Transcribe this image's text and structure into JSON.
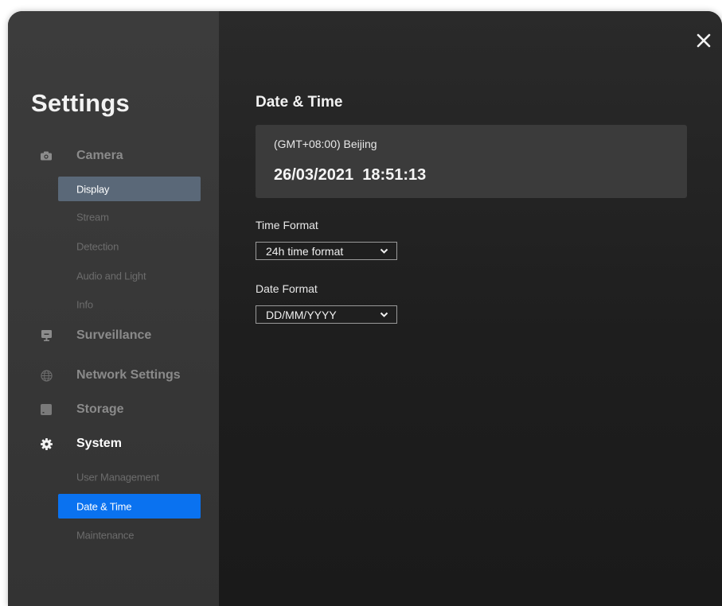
{
  "sidebar": {
    "title": "Settings",
    "groups": [
      {
        "label": "Camera",
        "icon": "camera-icon"
      },
      {
        "label": "Surveillance",
        "icon": "monitor-icon"
      },
      {
        "label": "Network Settings",
        "icon": "globe-icon"
      },
      {
        "label": "Storage",
        "icon": "storage-icon"
      },
      {
        "label": "System",
        "icon": "gear-icon"
      }
    ],
    "camera_items": [
      "Display",
      "Stream",
      "Detection",
      "Audio and Light",
      "Info"
    ],
    "system_items": [
      "User Management",
      "Date & Time",
      "Maintenance"
    ]
  },
  "main": {
    "title": "Date & Time",
    "timezone": "(GMT+08:00) Beijing",
    "datetime": "26/03/2021  18:51:13",
    "time_format": {
      "label": "Time Format",
      "value": "24h time format"
    },
    "date_format": {
      "label": "Date Format",
      "value": "DD/MM/YYYY"
    }
  },
  "colors": {
    "accent": "#0a72f0",
    "selected_gray": "#5a6878",
    "sidebar_bg": "#363636",
    "main_bg": "#1e1e1e",
    "card_bg": "#3b3b3b"
  }
}
